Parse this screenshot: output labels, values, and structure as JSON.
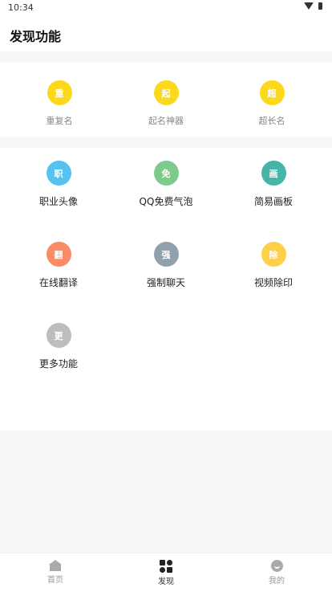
{
  "status": {
    "time": "10:34"
  },
  "header": {
    "title": "发现功能"
  },
  "colors": {
    "yellow": "#fcd81a",
    "blue": "#56c2f0",
    "green": "#7dcb88",
    "teal": "#46b4a8",
    "orange": "#f98c66",
    "slate": "#8fa2ab",
    "gold": "#fed04a",
    "grey": "#bdbdbd"
  },
  "section1": {
    "items": [
      {
        "icon_text": "重",
        "label": "重复名"
      },
      {
        "icon_text": "起",
        "label": "起名神器"
      },
      {
        "icon_text": "超",
        "label": "超长名"
      }
    ]
  },
  "section2": {
    "items": [
      {
        "icon_text": "职",
        "label": "职业头像"
      },
      {
        "icon_text": "免",
        "label": "QQ免费气泡"
      },
      {
        "icon_text": "画",
        "label": "简易画板"
      },
      {
        "icon_text": "翻",
        "label": "在线翻译"
      },
      {
        "icon_text": "强",
        "label": "强制聊天"
      },
      {
        "icon_text": "除",
        "label": "视频除印"
      },
      {
        "icon_text": "更",
        "label": "更多功能"
      }
    ]
  },
  "nav": {
    "home": "首页",
    "discover": "发现",
    "me": "我的"
  }
}
